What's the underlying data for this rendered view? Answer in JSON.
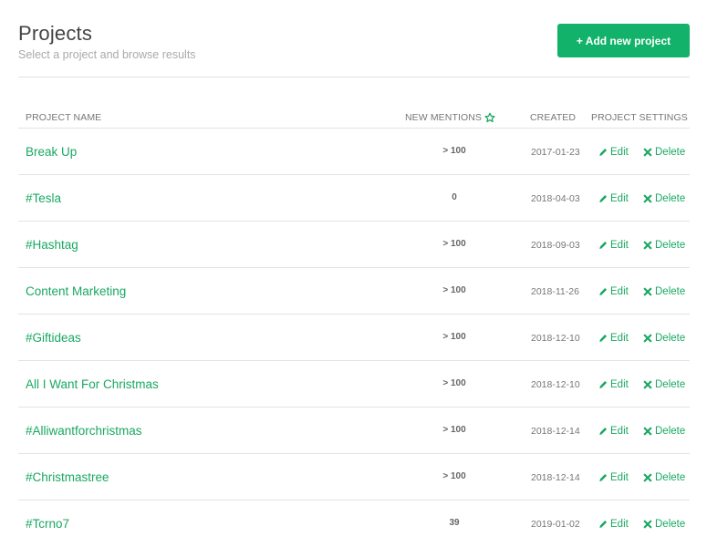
{
  "header": {
    "title": "Projects",
    "subtitle": "Select a project and browse results",
    "add_button_label": "+ Add new project"
  },
  "colors": {
    "accent": "#13b26b",
    "link": "#19a862",
    "divider": "#e3e3e3"
  },
  "table": {
    "columns": {
      "name": "Project Name",
      "mentions": "New Mentions",
      "mentions_icon": "star-outline-icon",
      "created": "Created",
      "settings": "Project Settings"
    },
    "edit_label": "Edit",
    "delete_label": "Delete",
    "rows": [
      {
        "name": "Break Up",
        "mentions": "> 100",
        "created": "2017-01-23"
      },
      {
        "name": "#Tesla",
        "mentions": "0",
        "created": "2018-04-03"
      },
      {
        "name": "#Hashtag",
        "mentions": "> 100",
        "created": "2018-09-03"
      },
      {
        "name": "Content Marketing",
        "mentions": "> 100",
        "created": "2018-11-26"
      },
      {
        "name": "#Giftideas",
        "mentions": "> 100",
        "created": "2018-12-10"
      },
      {
        "name": "All I Want For Christmas",
        "mentions": "> 100",
        "created": "2018-12-10"
      },
      {
        "name": "#Alliwantforchristmas",
        "mentions": "> 100",
        "created": "2018-12-14"
      },
      {
        "name": "#Christmastree",
        "mentions": "> 100",
        "created": "2018-12-14"
      },
      {
        "name": "#Tcrno7",
        "mentions": "39",
        "created": "2019-01-02"
      }
    ]
  }
}
